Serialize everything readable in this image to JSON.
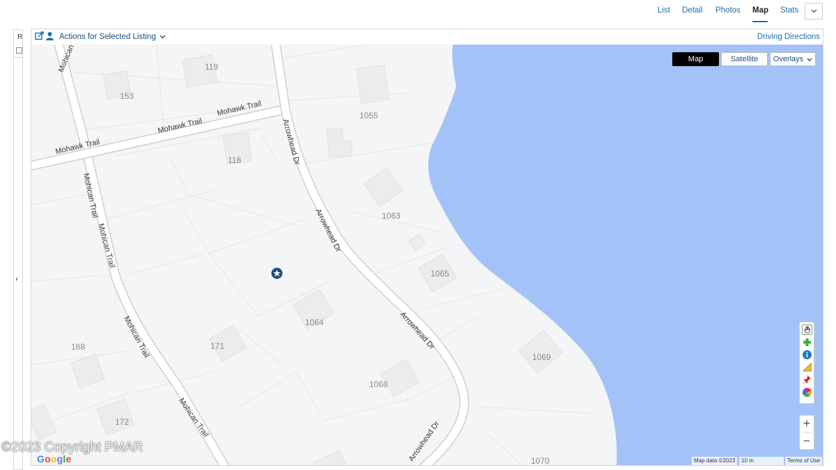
{
  "tabs": [
    {
      "label": "List",
      "active": false
    },
    {
      "label": "Detail",
      "active": false
    },
    {
      "label": "Photos",
      "active": false
    },
    {
      "label": "Map",
      "active": true
    },
    {
      "label": "Stats",
      "active": false
    }
  ],
  "left_panel": {
    "label": "R"
  },
  "map_toolbar": {
    "actions_label": "Actions for Selected Listing",
    "driving_directions": "Driving Directions"
  },
  "map_type": {
    "map": "Map",
    "satellite": "Satellite",
    "overlays": "Overlays"
  },
  "lot_numbers": {
    "l119": "119",
    "l153": "153",
    "l118": "118",
    "l1055": "1055",
    "l1063": "1063",
    "l1065": "1065",
    "l1064": "1064",
    "l171": "171",
    "l168": "168",
    "l1068": "1068",
    "l1069": "1069",
    "l172": "172",
    "l1070": "1070"
  },
  "roads": {
    "mohawk": "Mohawk Trail",
    "mohican": "Mohican Trail",
    "arrowhead": "Arrowhead Dr"
  },
  "attribution": {
    "map_data": "Map data ©2023",
    "scale": "10 m",
    "terms": "Terms of Use",
    "google": "Google"
  },
  "watermark": "©2023 Copyright PMAR",
  "colors": {
    "water": "#a3c2f7",
    "accent": "#1a6fa8",
    "land": "#f4f5f6"
  },
  "icons": [
    "edit-icon",
    "person-icon",
    "chevron-down-icon",
    "star-marker-icon",
    "hand-pan-icon",
    "add-icon",
    "info-icon",
    "measure-icon",
    "pin-icon",
    "color-wheel-icon",
    "zoom-in-icon",
    "zoom-out-icon"
  ]
}
